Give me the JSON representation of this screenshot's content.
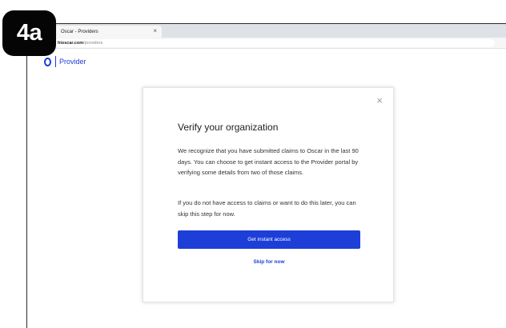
{
  "badge": {
    "label": "4a"
  },
  "browser": {
    "tab_title": "Oscar - Providers",
    "tab_close": "×",
    "url_host": "hioscar.com",
    "url_path": "/providers"
  },
  "header": {
    "brand": "Provider"
  },
  "modal": {
    "close": "×",
    "title": "Verify your organization",
    "paragraph1": "We recognize that you have submitted claims to Oscar in the last 90 days. You can choose to get instant access to the Provider portal by verifying some details from two of those claims.",
    "paragraph2": "If you do not have access to claims or want to do this later, you can skip this step for now.",
    "primary_button": "Get instant access",
    "skip_link": "Skip for now"
  },
  "colors": {
    "accent": "#1d3fd8",
    "badge": "#050505"
  },
  "icons": {
    "tab": "oscar-favicon-icon",
    "lock": "lock-icon",
    "logo": "oscar-logo-icon",
    "close": "close-icon"
  }
}
